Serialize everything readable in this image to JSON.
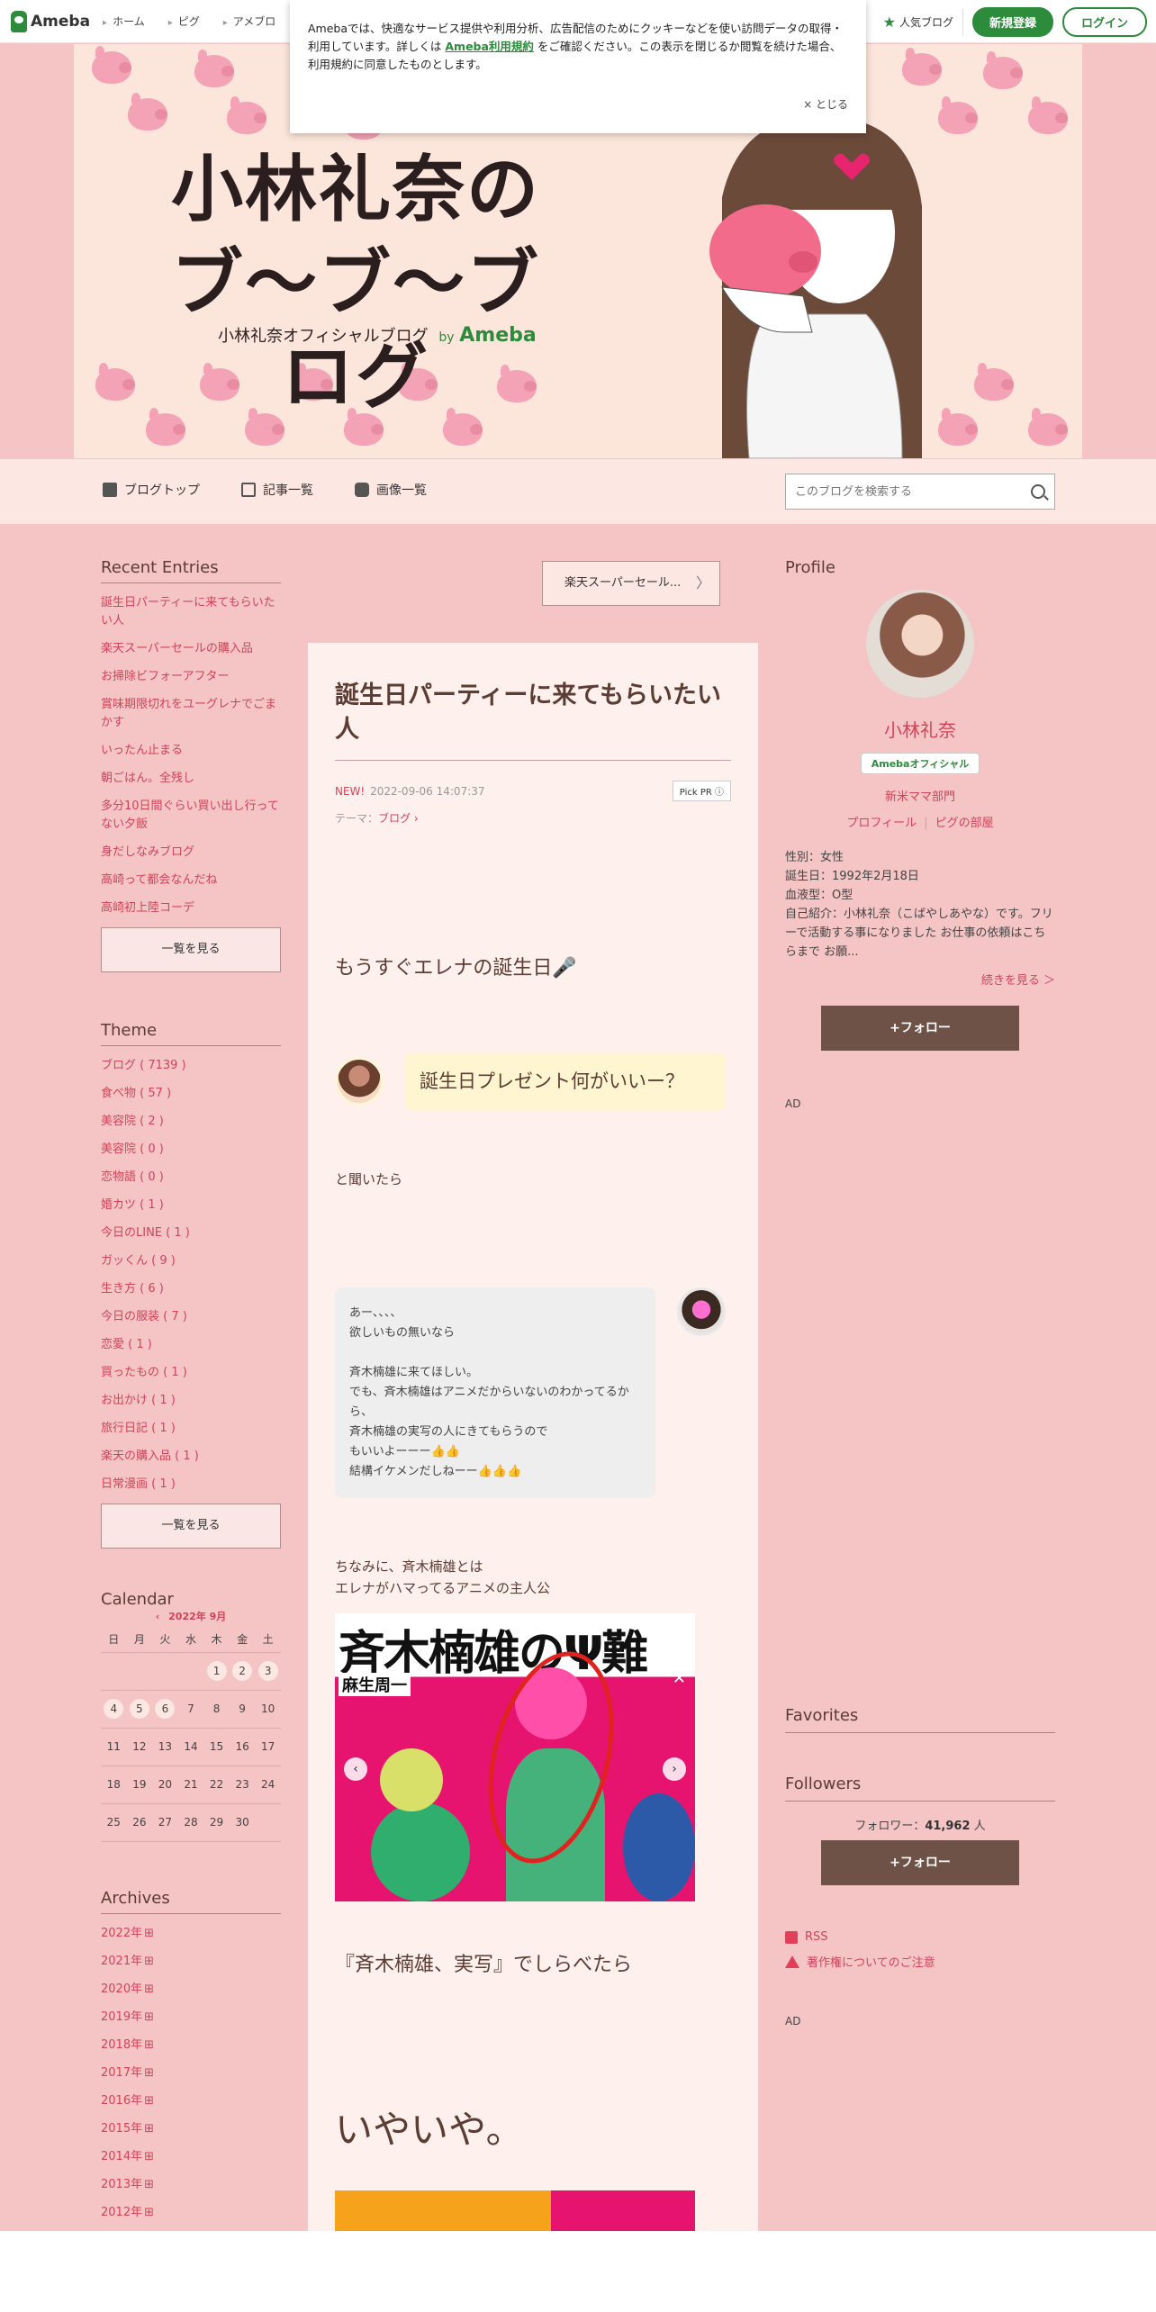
{
  "topbar": {
    "logo": "Ameba",
    "nav": [
      "ホーム",
      "ピグ",
      "アメブロ"
    ],
    "popular": "人気ブログ",
    "register": "新規登録",
    "login": "ログイン"
  },
  "cookie": {
    "text1": "Amebaでは、快適なサービス提供や利用分析、広告配信のためにクッキーなどを使い訪問データの取得・利用しています。詳しくは",
    "link": "Ameba利用規約",
    "text2": "をご確認ください。この表示を閉じるか閲覧を続けた場合、利用規約に同意したものとします。",
    "close": "× とじる"
  },
  "banner": {
    "title_line1": "小林礼奈の",
    "title_line2": "ブ〜ブ〜ブログ",
    "sub": "小林礼奈オフィシャルブログ",
    "by": "by",
    "ameba": "Ameba"
  },
  "subnav": {
    "items": [
      "ブログトップ",
      "記事一覧",
      "画像一覧"
    ],
    "search_placeholder": "このブログを検索する"
  },
  "recent": {
    "title": "Recent Entries",
    "items": [
      "誕生日パーティーに来てもらいたい人",
      "楽天スーパーセールの購入品",
      "お掃除ビフォーアフター",
      "賞味期限切れをユーグレナでごまかす",
      "いったん止まる",
      "朝ごはん。全残し",
      "多分10日間ぐらい買い出し行ってない夕飯",
      "身だしなみブログ",
      "高崎って都会なんだね",
      "高崎初上陸コーデ"
    ],
    "more": "一覧を見る"
  },
  "theme": {
    "title": "Theme",
    "items": [
      "ブログ ( 7139 )",
      "食べ物 ( 57 )",
      "美容院 ( 2 )",
      "美容院 ( 0 )",
      "恋物語 ( 0 )",
      "婚カツ ( 1 )",
      "今日のLINE ( 1 )",
      "ガッくん ( 9 )",
      "生き方 ( 6 )",
      "今日の服装 ( 7 )",
      "恋愛 ( 1 )",
      "買ったもの ( 1 )",
      "お出かけ ( 1 )",
      "旅行日記 ( 1 )",
      "楽天の購入品 ( 1 )",
      "日常漫画 ( 1 )"
    ],
    "more": "一覧を見る"
  },
  "calendar": {
    "title": "Calendar",
    "month": "2022年 9月",
    "dow": [
      "日",
      "月",
      "火",
      "水",
      "木",
      "金",
      "土"
    ],
    "weeks": [
      [
        "",
        "",
        "",
        "",
        "1",
        "2",
        "3"
      ],
      [
        "4",
        "5",
        "6",
        "7",
        "8",
        "9",
        "10"
      ],
      [
        "11",
        "12",
        "13",
        "14",
        "15",
        "16",
        "17"
      ],
      [
        "18",
        "19",
        "20",
        "21",
        "22",
        "23",
        "24"
      ],
      [
        "25",
        "26",
        "27",
        "28",
        "29",
        "30",
        ""
      ]
    ],
    "posted": [
      "1",
      "2",
      "3",
      "4",
      "5",
      "6"
    ]
  },
  "archives": {
    "title": "Archives",
    "items": [
      "2022年",
      "2021年",
      "2020年",
      "2019年",
      "2018年",
      "2017年",
      "2016年",
      "2015年",
      "2014年",
      "2013年",
      "2012年"
    ]
  },
  "article": {
    "pr_button": "楽天スーパーセール...",
    "title": "誕生日パーティーに来てもらいたい人",
    "new": "NEW!",
    "date": "2022-09-06 14:07:37",
    "pick_pr": "Pick PR ⓘ",
    "theme_label": "テーマ：",
    "theme": "ブログ",
    "lead": "もうすぐエレナの誕生日🎤",
    "bubble_question": "誕生日プレゼント何がいいー？",
    "asked": "と聞いたら",
    "reply": "あー、、、、\n欲しいもの無いなら\n\n斉木楠雄に来てほしい。\nでも、斉木楠雄はアニメだからいないのわかってるから、\n斉木楠雄の実写の人にきてもらうので\nもいいよーーー👍👍\n結構イケメンだしねーー👍👍👍",
    "note": "ちなみに、斉木楠雄とは\nエレナがハマってるアニメの主人公",
    "manga_title": "斉木楠雄のΨ難",
    "manga_author": "麻生周一",
    "sub": "『斉木楠雄、実写』でしらべたら",
    "big": "いやいや。"
  },
  "profile": {
    "title": "Profile",
    "name": "小林礼奈",
    "official": "Amebaオフィシャル",
    "category": "新米ママ部門",
    "link1": "プロフィール",
    "link2": "ピグの部屋",
    "info": [
      "性別：女性",
      "誕生日：1992年2月18日",
      "血液型：O型",
      "自己紹介：小林礼奈（こばやしあやな）です。フリーで活動する事になりました お仕事の依頼はこちらまで お願..."
    ],
    "more": "続きを見る ＞",
    "follow": "+フォロー",
    "ad": "AD"
  },
  "favorites": {
    "title": "Favorites"
  },
  "followers": {
    "title": "Followers",
    "label": "フォロワー：",
    "count": "41,962",
    "unit": "人",
    "follow": "+フォロー"
  },
  "footer_links": {
    "rss": "RSS",
    "copyright": "著作権についてのご注意",
    "ad": "AD"
  }
}
